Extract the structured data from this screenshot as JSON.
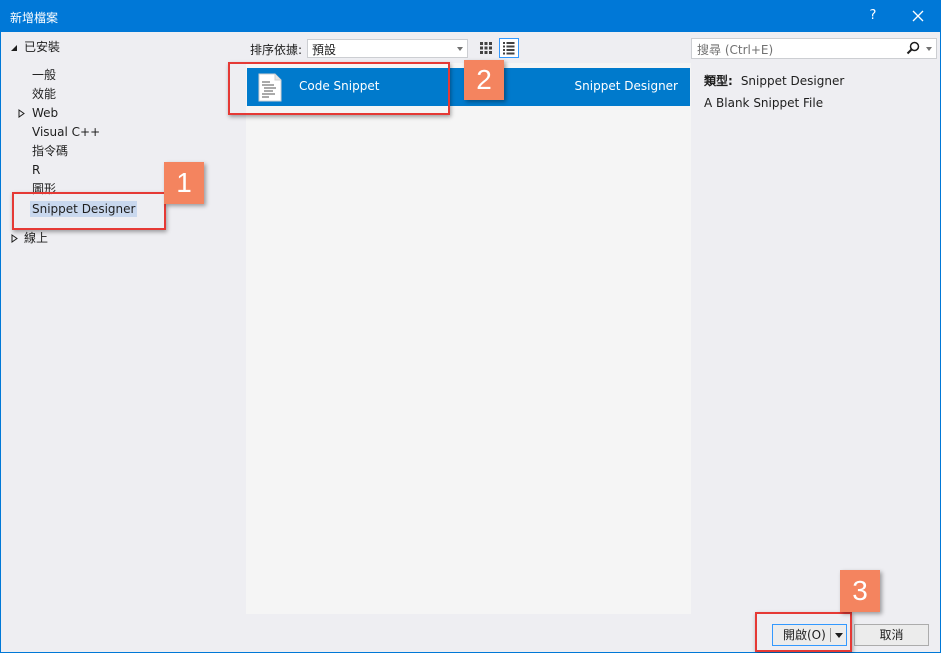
{
  "window": {
    "title": "新增檔案",
    "help_label": "?"
  },
  "tree": {
    "installed_label": "已安裝",
    "items": [
      {
        "label": "一般"
      },
      {
        "label": "效能"
      },
      {
        "label": "Web"
      },
      {
        "label": "Visual C++"
      },
      {
        "label": "指令碼"
      },
      {
        "label": "R"
      },
      {
        "label": "圖形"
      },
      {
        "label": "Snippet Designer"
      }
    ],
    "online_label": "線上"
  },
  "toolbar": {
    "sort_label": "排序依據:",
    "sort_value": "預設"
  },
  "templates": [
    {
      "name": "Code Snippet",
      "type": "Snippet Designer"
    }
  ],
  "search": {
    "placeholder": "搜尋 (Ctrl+E)"
  },
  "details": {
    "type_label": "類型:",
    "type_value": "Snippet Designer",
    "description": "A Blank Snippet File"
  },
  "buttons": {
    "open_label": "開啟(O)",
    "cancel_label": "取消"
  },
  "annotations": {
    "step1": "1",
    "step2": "2",
    "step3": "3"
  },
  "colors": {
    "accent": "#0078d7",
    "selection": "#007acc",
    "highlight": "#e53935",
    "badge": "#f4845f"
  }
}
